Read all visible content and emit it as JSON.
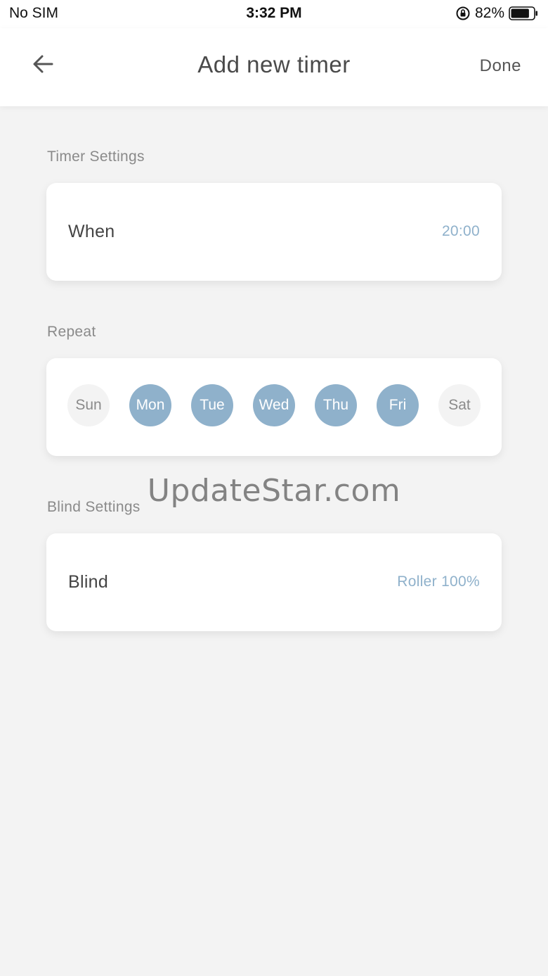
{
  "status_bar": {
    "carrier": "No SIM",
    "time": "3:32 PM",
    "battery": "82%",
    "battery_level": 0.82,
    "icons": [
      "rotation-lock-icon",
      "battery-icon"
    ]
  },
  "nav": {
    "title": "Add new timer",
    "done_label": "Done",
    "back_icon": "arrow-left-icon"
  },
  "timer_settings": {
    "section_label": "Timer Settings",
    "when_label": "When",
    "when_value": "20:00"
  },
  "repeat": {
    "section_label": "Repeat",
    "days": [
      {
        "label": "Sun",
        "selected": false
      },
      {
        "label": "Mon",
        "selected": true
      },
      {
        "label": "Tue",
        "selected": true
      },
      {
        "label": "Wed",
        "selected": true
      },
      {
        "label": "Thu",
        "selected": true
      },
      {
        "label": "Fri",
        "selected": true
      },
      {
        "label": "Sat",
        "selected": false
      }
    ]
  },
  "blind_settings": {
    "section_label": "Blind Settings",
    "blind_label": "Blind",
    "blind_value": "Roller 100%"
  },
  "watermark": "UpdateStar.com",
  "colors": {
    "accent": "#8fb1cb",
    "background": "#f3f3f3",
    "card": "#ffffff"
  }
}
